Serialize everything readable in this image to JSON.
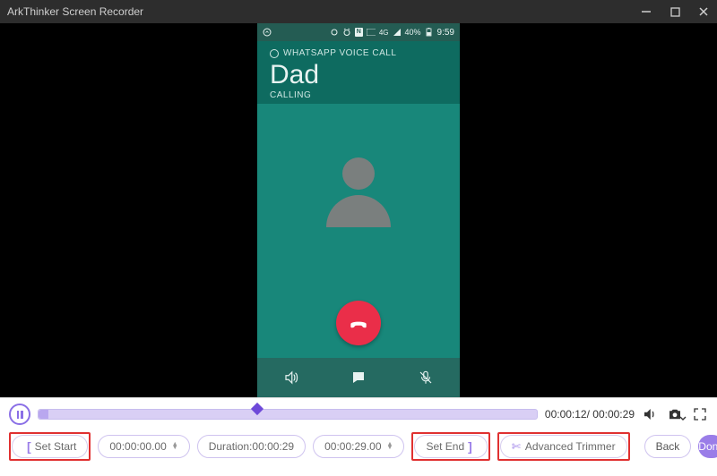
{
  "titlebar": {
    "title": "ArkThinker Screen Recorder"
  },
  "phone": {
    "statusbar": {
      "nfc": "N",
      "fourg": "4G",
      "battery": "40%",
      "time": "9:59"
    },
    "wa_label": "WHATSAPP VOICE CALL",
    "caller": "Dad",
    "state": "CALLING"
  },
  "playback": {
    "current": "00:00:12",
    "total": "00:00:29"
  },
  "trim": {
    "set_start_label": "Set Start",
    "start_value": "00:00:00.00",
    "duration_label": "Duration:00:00:29",
    "end_value": "00:00:29.00",
    "set_end_label": "Set End",
    "advanced_label": "Advanced Trimmer"
  },
  "buttons": {
    "back": "Back",
    "done": "Done"
  }
}
